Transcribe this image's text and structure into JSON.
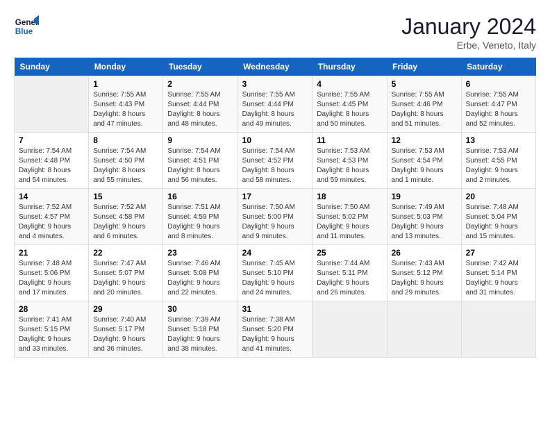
{
  "logo": {
    "line1": "General",
    "line2": "Blue"
  },
  "title": "January 2024",
  "location": "Erbe, Veneto, Italy",
  "days_of_week": [
    "Sunday",
    "Monday",
    "Tuesday",
    "Wednesday",
    "Thursday",
    "Friday",
    "Saturday"
  ],
  "weeks": [
    [
      {
        "day": "",
        "info": ""
      },
      {
        "day": "1",
        "info": "Sunrise: 7:55 AM\nSunset: 4:43 PM\nDaylight: 8 hours\nand 47 minutes."
      },
      {
        "day": "2",
        "info": "Sunrise: 7:55 AM\nSunset: 4:44 PM\nDaylight: 8 hours\nand 48 minutes."
      },
      {
        "day": "3",
        "info": "Sunrise: 7:55 AM\nSunset: 4:44 PM\nDaylight: 8 hours\nand 49 minutes."
      },
      {
        "day": "4",
        "info": "Sunrise: 7:55 AM\nSunset: 4:45 PM\nDaylight: 8 hours\nand 50 minutes."
      },
      {
        "day": "5",
        "info": "Sunrise: 7:55 AM\nSunset: 4:46 PM\nDaylight: 8 hours\nand 51 minutes."
      },
      {
        "day": "6",
        "info": "Sunrise: 7:55 AM\nSunset: 4:47 PM\nDaylight: 8 hours\nand 52 minutes."
      }
    ],
    [
      {
        "day": "7",
        "info": "Sunrise: 7:54 AM\nSunset: 4:48 PM\nDaylight: 8 hours\nand 54 minutes."
      },
      {
        "day": "8",
        "info": "Sunrise: 7:54 AM\nSunset: 4:50 PM\nDaylight: 8 hours\nand 55 minutes."
      },
      {
        "day": "9",
        "info": "Sunrise: 7:54 AM\nSunset: 4:51 PM\nDaylight: 8 hours\nand 56 minutes."
      },
      {
        "day": "10",
        "info": "Sunrise: 7:54 AM\nSunset: 4:52 PM\nDaylight: 8 hours\nand 58 minutes."
      },
      {
        "day": "11",
        "info": "Sunrise: 7:53 AM\nSunset: 4:53 PM\nDaylight: 8 hours\nand 59 minutes."
      },
      {
        "day": "12",
        "info": "Sunrise: 7:53 AM\nSunset: 4:54 PM\nDaylight: 9 hours\nand 1 minute."
      },
      {
        "day": "13",
        "info": "Sunrise: 7:53 AM\nSunset: 4:55 PM\nDaylight: 9 hours\nand 2 minutes."
      }
    ],
    [
      {
        "day": "14",
        "info": "Sunrise: 7:52 AM\nSunset: 4:57 PM\nDaylight: 9 hours\nand 4 minutes."
      },
      {
        "day": "15",
        "info": "Sunrise: 7:52 AM\nSunset: 4:58 PM\nDaylight: 9 hours\nand 6 minutes."
      },
      {
        "day": "16",
        "info": "Sunrise: 7:51 AM\nSunset: 4:59 PM\nDaylight: 9 hours\nand 8 minutes."
      },
      {
        "day": "17",
        "info": "Sunrise: 7:50 AM\nSunset: 5:00 PM\nDaylight: 9 hours\nand 9 minutes."
      },
      {
        "day": "18",
        "info": "Sunrise: 7:50 AM\nSunset: 5:02 PM\nDaylight: 9 hours\nand 11 minutes."
      },
      {
        "day": "19",
        "info": "Sunrise: 7:49 AM\nSunset: 5:03 PM\nDaylight: 9 hours\nand 13 minutes."
      },
      {
        "day": "20",
        "info": "Sunrise: 7:48 AM\nSunset: 5:04 PM\nDaylight: 9 hours\nand 15 minutes."
      }
    ],
    [
      {
        "day": "21",
        "info": "Sunrise: 7:48 AM\nSunset: 5:06 PM\nDaylight: 9 hours\nand 17 minutes."
      },
      {
        "day": "22",
        "info": "Sunrise: 7:47 AM\nSunset: 5:07 PM\nDaylight: 9 hours\nand 20 minutes."
      },
      {
        "day": "23",
        "info": "Sunrise: 7:46 AM\nSunset: 5:08 PM\nDaylight: 9 hours\nand 22 minutes."
      },
      {
        "day": "24",
        "info": "Sunrise: 7:45 AM\nSunset: 5:10 PM\nDaylight: 9 hours\nand 24 minutes."
      },
      {
        "day": "25",
        "info": "Sunrise: 7:44 AM\nSunset: 5:11 PM\nDaylight: 9 hours\nand 26 minutes."
      },
      {
        "day": "26",
        "info": "Sunrise: 7:43 AM\nSunset: 5:12 PM\nDaylight: 9 hours\nand 29 minutes."
      },
      {
        "day": "27",
        "info": "Sunrise: 7:42 AM\nSunset: 5:14 PM\nDaylight: 9 hours\nand 31 minutes."
      }
    ],
    [
      {
        "day": "28",
        "info": "Sunrise: 7:41 AM\nSunset: 5:15 PM\nDaylight: 9 hours\nand 33 minutes."
      },
      {
        "day": "29",
        "info": "Sunrise: 7:40 AM\nSunset: 5:17 PM\nDaylight: 9 hours\nand 36 minutes."
      },
      {
        "day": "30",
        "info": "Sunrise: 7:39 AM\nSunset: 5:18 PM\nDaylight: 9 hours\nand 38 minutes."
      },
      {
        "day": "31",
        "info": "Sunrise: 7:38 AM\nSunset: 5:20 PM\nDaylight: 9 hours\nand 41 minutes."
      },
      {
        "day": "",
        "info": ""
      },
      {
        "day": "",
        "info": ""
      },
      {
        "day": "",
        "info": ""
      }
    ]
  ]
}
